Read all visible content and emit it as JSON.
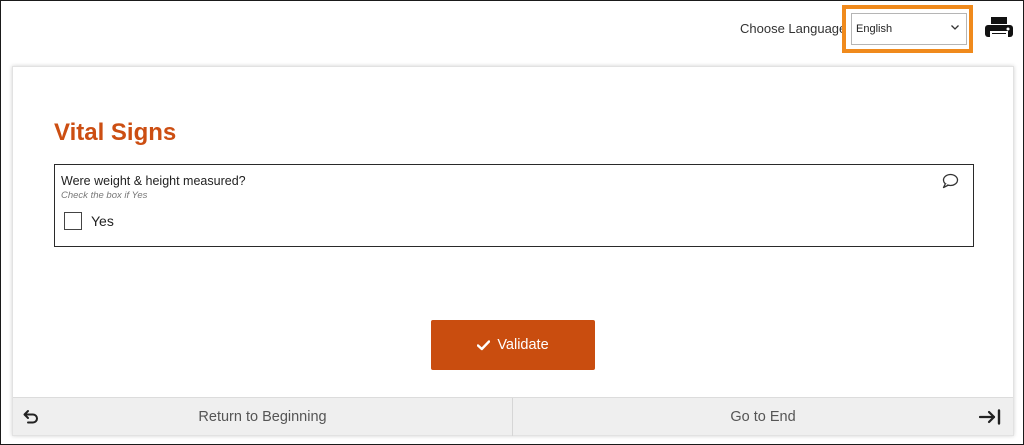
{
  "header": {
    "language_label": "Choose Language",
    "language_selected": "English",
    "icons": {
      "dropdown": "chevron-down-icon",
      "print": "printer-icon"
    },
    "highlight_color": "#f08a1c"
  },
  "section": {
    "title": "Vital Signs",
    "title_color": "#cc4e12"
  },
  "question": {
    "text": "Were weight & height measured?",
    "hint": "Check the box if Yes",
    "option_label": "Yes",
    "checked": false,
    "comment_icon": "comment-icon"
  },
  "actions": {
    "validate_label": "Validate",
    "validate_icon": "checkmark-icon",
    "button_color": "#c94d0f"
  },
  "footer": {
    "return_label": "Return to Beginning",
    "return_icon": "return-arrow-icon",
    "end_label": "Go to End",
    "end_icon": "arrow-to-end-icon"
  }
}
